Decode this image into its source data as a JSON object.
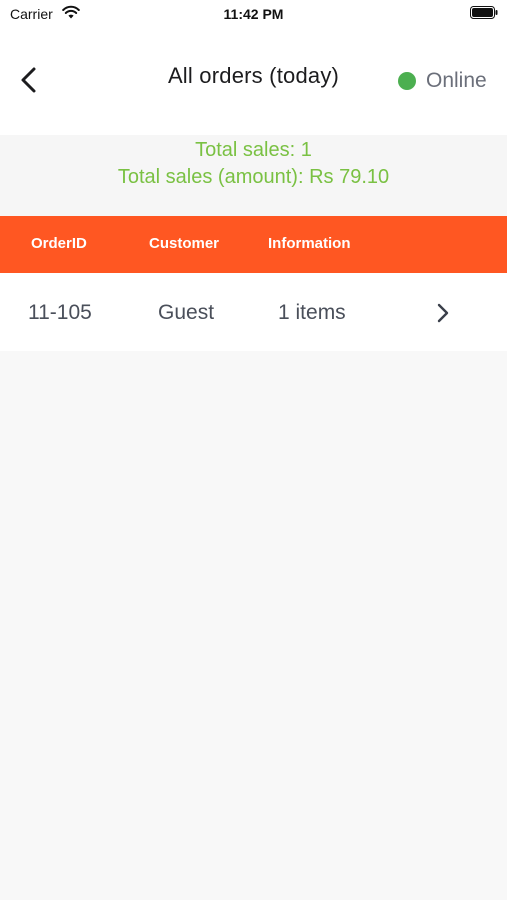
{
  "status_bar": {
    "carrier": "Carrier",
    "time": "11:42 PM",
    "icons": [
      "wifi-icon",
      "battery-icon"
    ]
  },
  "header": {
    "title": "All orders (today)",
    "back_icon": "chevron-left-icon",
    "status_label": "Online",
    "status_color": "#4caf50"
  },
  "summary": {
    "total_sales": "Total sales: 1",
    "total_amount": "Total sales (amount): Rs 79.10",
    "color": "#7ac143"
  },
  "table": {
    "header_color": "#ff5722",
    "columns": [
      "OrderID",
      "Customer",
      "Information"
    ],
    "rows": [
      {
        "order_id": "11-105",
        "customer": "Guest",
        "information": "1 items",
        "action_icon": "chevron-right-icon"
      }
    ]
  }
}
